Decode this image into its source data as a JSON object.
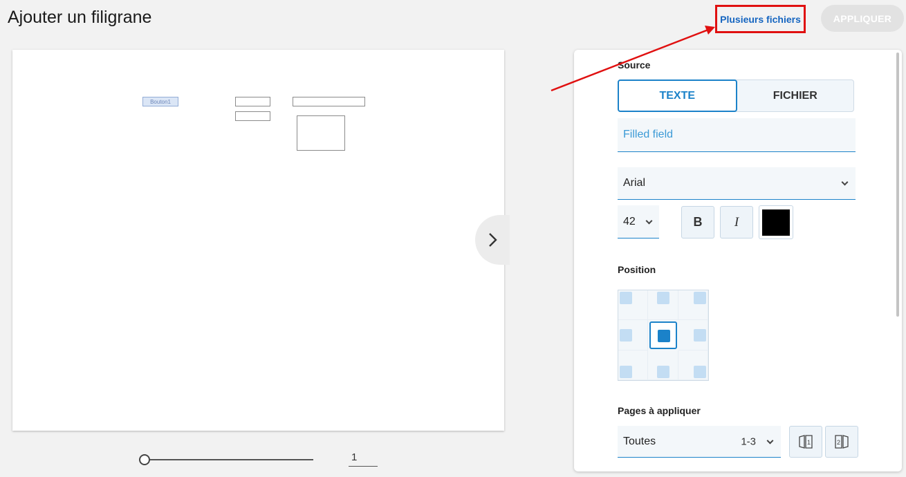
{
  "header": {
    "title": "Ajouter un filigrane",
    "multi_files_link": "Plusieurs fichiers",
    "apply_button": "APPLIQUER"
  },
  "preview": {
    "button_label": "Bouton1",
    "next_icon": "chevron-right-icon"
  },
  "pager": {
    "page_value": "1"
  },
  "panel": {
    "source_label": "Source",
    "source_options": [
      "TEXTE",
      "FICHIER"
    ],
    "source_selected": "TEXTE",
    "text_value": "Filled field",
    "font_value": "Arial",
    "size_value": "42",
    "bold_label": "B",
    "italic_label": "I",
    "text_color": "#000000",
    "position_label": "Position",
    "position_selected": "middle-center",
    "pages_label": "Pages à appliquer",
    "pages_value": "Toutes",
    "pages_range": "1-3"
  },
  "colors": {
    "accent": "#1b82c9",
    "annotation": "#e01010"
  }
}
